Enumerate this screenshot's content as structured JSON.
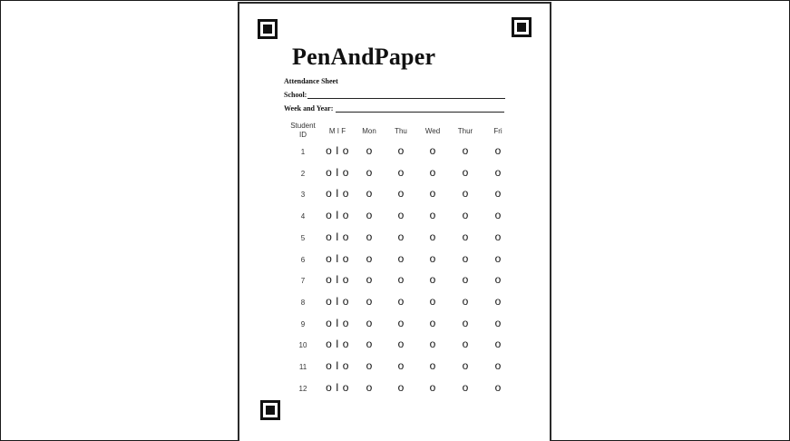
{
  "sheet": {
    "title": "PenAndPaper",
    "subtitle": "Attendance Sheet",
    "school_label": "School:",
    "week_label": "Week and Year:"
  },
  "table": {
    "headers": [
      "Student ID",
      "M I F",
      "Mon",
      "Thu",
      "Wed",
      "Thur",
      "Fri"
    ],
    "mark_pair": "o I o",
    "mark": "o",
    "student_ids": [
      "1",
      "2",
      "3",
      "4",
      "5",
      "6",
      "7",
      "8",
      "9",
      "10",
      "11",
      "12"
    ]
  }
}
